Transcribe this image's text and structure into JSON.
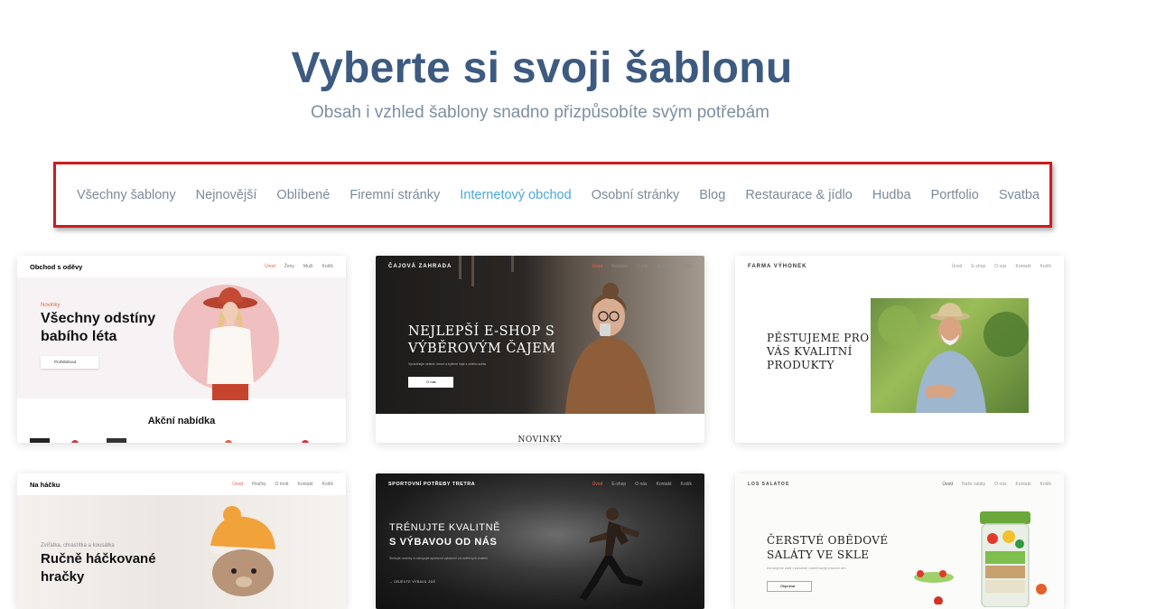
{
  "header": {
    "title": "Vyberte si svoji šablonu",
    "subtitle": "Obsah i vzhled šablony snadno přizpůsobíte svým potřebám"
  },
  "filters": {
    "items": [
      "Všechny šablony",
      "Nejnovější",
      "Oblíbené",
      "Firemní stránky",
      "Internetový obchod",
      "Osobní stránky",
      "Blog",
      "Restaurace & jídlo",
      "Hudba",
      "Portfolio",
      "Svatba"
    ],
    "active": "Internetový obchod",
    "active_color": "#4ba8d8"
  },
  "templates": [
    {
      "brand": "Obchod s oděvy",
      "nav": [
        "Úvod",
        "Ženy",
        "Muži",
        "Košík"
      ],
      "kicker": "Novinky",
      "title_line1": "Všechny odstíny",
      "title_line2": "babího léta",
      "button": "Prohlédnout",
      "section": "Akční nabídka"
    },
    {
      "brand": "ČAJOVÁ ZAHRADA",
      "nav": [
        "Úvod",
        "Kontakt",
        "O nás",
        "E-shop",
        "Košík"
      ],
      "title_line1": "NEJLEPŠÍ E-SHOP S",
      "title_line2": "VÝBĚROVÝM ČAJEM",
      "small": "Vychutnejte zelené, černé a bylinné čaje z celého světa",
      "button": "O nás",
      "section": "NOVINKY"
    },
    {
      "brand": "FARMA VÝHONEK",
      "nav": [
        "Úvod",
        "E-shop",
        "O nás",
        "Kontakt",
        "Košík"
      ],
      "title_line1": "PĚSTUJEME PRO",
      "title_line2": "VÁS KVALITNÍ",
      "title_line3": "PRODUKTY"
    },
    {
      "brand": "Na háčku",
      "nav": [
        "Úvod",
        "Hračky",
        "O mně",
        "Kontakt",
        "Košík"
      ],
      "kicker": "Zvířátka, chrastítka a kousátka",
      "title_line1": "Ručně háčkované",
      "title_line2": "hračky"
    },
    {
      "brand": "SPORTOVNÍ POTŘEBY TRETRA",
      "nav": [
        "Úvod",
        "E-shop",
        "O nás",
        "Kontakt",
        "Košík"
      ],
      "title_line1": "TRÉNUJTE KVALITNĚ",
      "title_line2": "S VÝBAVOU OD NÁS",
      "small": "Sledujte novinky a nakupujte sportovní vybavení od ověřených značek",
      "link": "→ OBJEVTE VÝBAVU ZDE"
    },
    {
      "brand": "LOS SALATOS",
      "nav": [
        "Úvod",
        "Naše saláty",
        "O nás",
        "Kontakt",
        "Košík"
      ],
      "title_line1": "ČERSTVÉ OBĚDOVÉ",
      "title_line2": "SALÁTY VE SKLE",
      "small": "Doručujeme salát v kanceláři i domů každý pracovní den",
      "button": "Objednat"
    }
  ]
}
